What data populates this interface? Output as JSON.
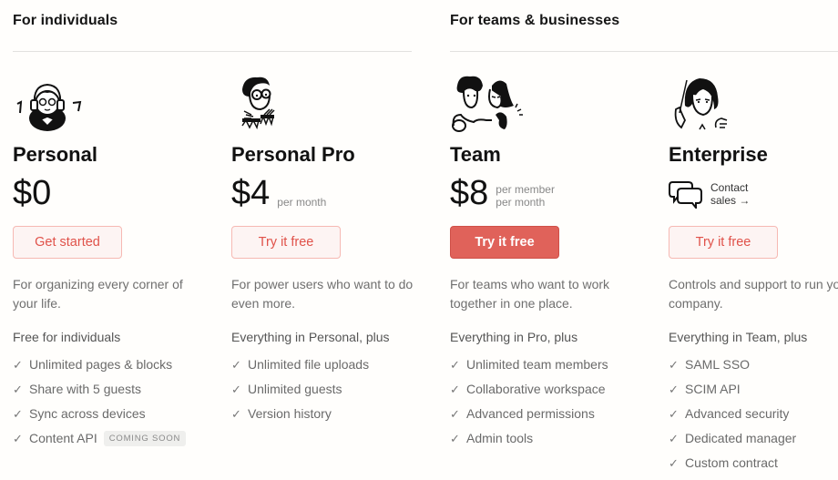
{
  "groups": [
    {
      "title": "For individuals"
    },
    {
      "title": "For teams & businesses"
    }
  ],
  "plans": [
    {
      "name": "Personal",
      "illustration": "person-with-headphones-illustration",
      "price": "$0",
      "price_note": "",
      "button": "Get started",
      "button_style": "outline",
      "description": "For organizing every corner of your life.",
      "features_heading": "Free for individuals",
      "features": [
        "Unlimited pages & blocks",
        "Share with 5 guests",
        "Sync across devices",
        "Content API"
      ],
      "feature_badge": "COMING SOON"
    },
    {
      "name": "Personal Pro",
      "illustration": "person-with-glasses-illustration",
      "price": "$4",
      "price_note": "per month",
      "button": "Try it free",
      "button_style": "outline",
      "description": "For power users who want to do even more.",
      "features_heading": "Everything in Personal, plus",
      "features": [
        "Unlimited file uploads",
        "Unlimited guests",
        "Version history"
      ]
    },
    {
      "name": "Team",
      "illustration": "two-people-illustration",
      "price": "$8",
      "price_note_line1": "per member",
      "price_note_line2": "per month",
      "button": "Try it free",
      "button_style": "solid",
      "description": "For teams who want to work together in one place.",
      "features_heading": "Everything in Pro, plus",
      "features": [
        "Unlimited team members",
        "Collaborative workspace",
        "Advanced permissions",
        "Admin tools"
      ]
    },
    {
      "name": "Enterprise",
      "illustration": "conductor-illustration",
      "contact_line1": "Contact",
      "contact_line2": "sales →",
      "contact_icon": "chat-bubbles-icon",
      "button": "Try it free",
      "button_style": "outline",
      "description": "Controls and support to run your company.",
      "features_heading": "Everything in Team, plus",
      "features": [
        "SAML SSO",
        "SCIM API",
        "Advanced security",
        "Dedicated manager",
        "Custom contract"
      ]
    }
  ],
  "check_glyph": "✓",
  "colors": {
    "accent": "#e0625a",
    "accent_text": "#e0524a",
    "outline_bg": "#fdf4f3",
    "outline_border": "#f6b9b3"
  }
}
